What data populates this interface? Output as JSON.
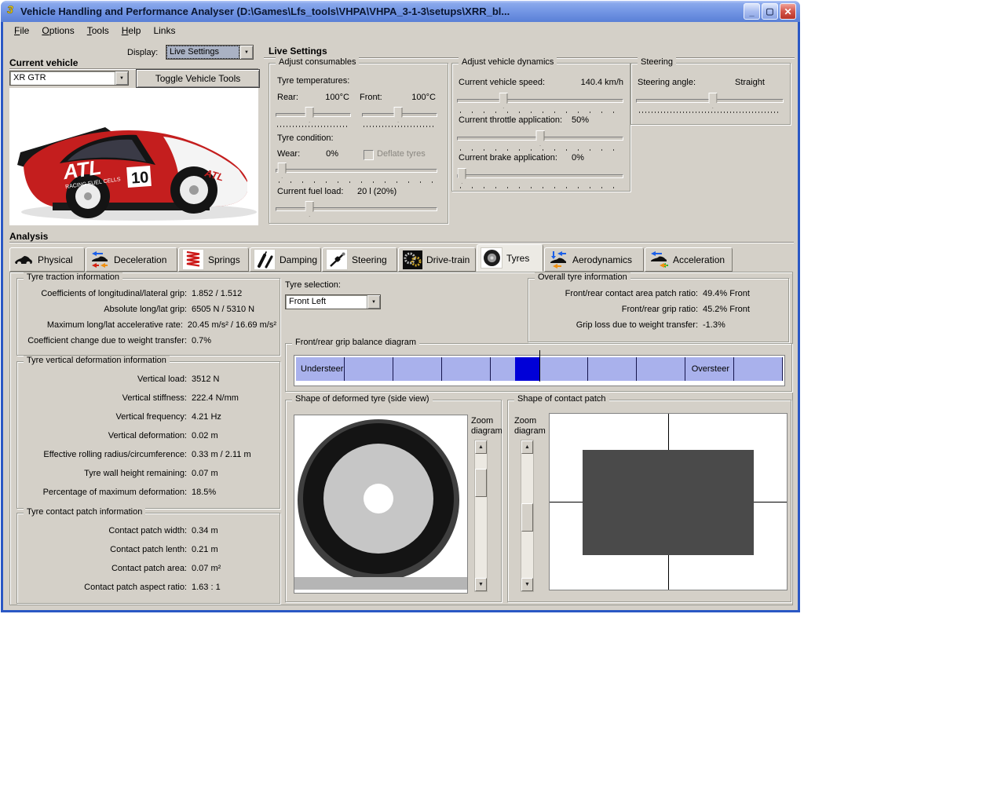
{
  "glyphs": {
    "minimize": "_",
    "maximize": "▢",
    "close": "✕",
    "combo_arrow": "▼",
    "scroll_up": "▲",
    "scroll_down": "▼"
  },
  "colors": {
    "titlebar_top": "#b5c9f6",
    "titlebar_bottom": "#5a80d6",
    "window_bg": "#d4d0c8",
    "grip_segment": "#a9b1ec",
    "grip_highlight": "#0000d8",
    "patch_fill": "#4a4a4a",
    "close_red": "#c33d31"
  },
  "window": {
    "title": "Vehicle Handling and Performance Analyser (D:\\Games\\Lfs_tools\\VHPA\\VHPA_3-1-3\\setups\\XRR_bl...",
    "menu": [
      "File",
      "Options",
      "Tools",
      "Help",
      "Links"
    ]
  },
  "display": {
    "label": "Display:",
    "value": "Live Settings"
  },
  "vehicle": {
    "section_label": "Current vehicle",
    "selected": "XR GTR",
    "toggle_button": "Toggle Vehicle Tools"
  },
  "car_image": {
    "number": "10",
    "brand": "ATL",
    "sub_brand": "RACING FUEL CELLS"
  },
  "live": {
    "section_label": "Live Settings"
  },
  "consumables": {
    "title": "Adjust consumables",
    "tyre_temps_label": "Tyre temperatures:",
    "rear_label": "Rear:",
    "rear_value": "100°C",
    "front_label": "Front:",
    "front_value": "100°C",
    "tyre_condition_label": "Tyre condition:",
    "wear_label": "Wear:",
    "wear_value": "0%",
    "deflate_label": "Deflate tyres",
    "fuel_label": "Current fuel load:",
    "fuel_value": "20 l (20%)"
  },
  "dynamics": {
    "title": "Adjust vehicle dynamics",
    "speed_label": "Current vehicle speed:",
    "speed_value": "140.4 km/h",
    "throttle_label": "Current throttle application:",
    "throttle_value": "50%",
    "brake_label": "Current brake application:",
    "brake_value": "0%"
  },
  "steering": {
    "title": "Steering",
    "angle_label": "Steering angle:",
    "angle_value": "Straight"
  },
  "analysis": {
    "section_label": "Analysis",
    "tabs": [
      {
        "label": "Physical"
      },
      {
        "label": "Deceleration"
      },
      {
        "label": "Springs"
      },
      {
        "label": "Damping"
      },
      {
        "label": "Steering"
      },
      {
        "label": "Drive-train"
      },
      {
        "label": "Tyres"
      },
      {
        "label": "Aerodynamics"
      },
      {
        "label": "Acceleration"
      }
    ]
  },
  "traction": {
    "title": "Tyre traction information",
    "rows": [
      {
        "label": "Coefficients of longitudinal/lateral grip:",
        "value": "1.852 / 1.512"
      },
      {
        "label": "Absolute long/lat grip:",
        "value": "6505 N / 5310 N"
      },
      {
        "label": "Maximum long/lat accelerative rate:",
        "value": "20.45 m/s² / 16.69 m/s²"
      },
      {
        "label": "Coefficient change due to weight transfer:",
        "value": "0.7%"
      }
    ]
  },
  "deformation": {
    "title": "Tyre vertical deformation information",
    "rows": [
      {
        "label": "Vertical load:",
        "value": "3512 N"
      },
      {
        "label": "Vertical stiffness:",
        "value": "222.4 N/mm"
      },
      {
        "label": "Vertical frequency:",
        "value": "4.21 Hz"
      },
      {
        "label": "Vertical deformation:",
        "value": "0.02 m"
      },
      {
        "label": "Effective rolling radius/circumference:",
        "value": "0.33 m / 2.11 m"
      },
      {
        "label": "Tyre wall height remaining:",
        "value": "0.07 m"
      },
      {
        "label": "Percentage of maximum deformation:",
        "value": "18.5%"
      }
    ]
  },
  "contact": {
    "title": "Tyre contact patch information",
    "rows": [
      {
        "label": "Contact patch width:",
        "value": "0.34 m"
      },
      {
        "label": "Contact patch lenth:",
        "value": "0.21 m"
      },
      {
        "label": "Contact patch area:",
        "value": "0.07 m²"
      },
      {
        "label": "Contact patch aspect ratio:",
        "value": "1.63 : 1"
      }
    ]
  },
  "tyre_selection": {
    "label": "Tyre selection:",
    "value": "Front Left"
  },
  "overall": {
    "title": "Overall tyre information",
    "rows": [
      {
        "label": "Front/rear contact area patch ratio:",
        "value": "49.4% Front"
      },
      {
        "label": "Front/rear grip ratio:",
        "value": "45.2% Front"
      },
      {
        "label": "Grip loss due to weight transfer:",
        "value": "-1.3%"
      }
    ]
  },
  "grip_balance": {
    "title": "Front/rear grip balance diagram",
    "left_label": "Understeer",
    "right_label": "Oversteer",
    "segments": 10,
    "highlight_start_pct": 45,
    "highlight_end_pct": 50
  },
  "deformed_tyre": {
    "title": "Shape of deformed tyre (side view)",
    "zoom_label": "Zoom diagram"
  },
  "contact_patch": {
    "title": "Shape of contact patch",
    "zoom_label": "Zoom diagram"
  }
}
